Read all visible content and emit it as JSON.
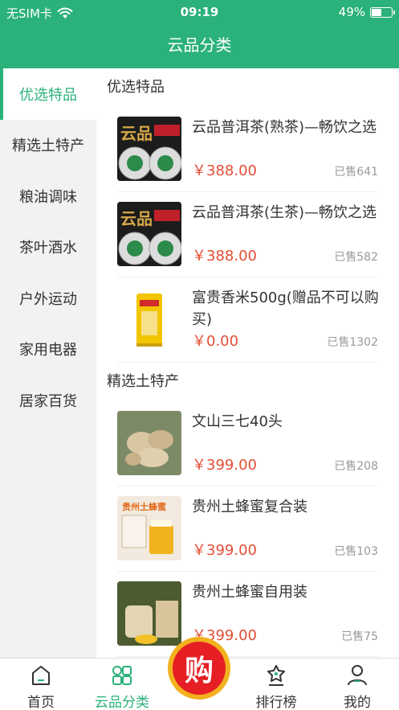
{
  "status": {
    "carrier": "无SIM卡",
    "time": "09:19",
    "battery": "49%",
    "battery_level": 0.49
  },
  "header": {
    "title": "云品分类"
  },
  "sidebar": {
    "items": [
      {
        "label": "优选特品",
        "active": true
      },
      {
        "label": "精选土特产",
        "active": false
      },
      {
        "label": "粮油调味",
        "active": false
      },
      {
        "label": "茶叶酒水",
        "active": false
      },
      {
        "label": "户外运动",
        "active": false
      },
      {
        "label": "家用电器",
        "active": false
      },
      {
        "label": "居家百货",
        "active": false
      }
    ]
  },
  "sections": [
    {
      "title": "优选特品",
      "products": [
        {
          "name": "云品普洱茶(熟茶)—畅饮之选",
          "price": "￥388.00",
          "sold": "已售641",
          "image_text": "云品"
        },
        {
          "name": "云品普洱茶(生茶)—畅饮之选",
          "price": "￥388.00",
          "sold": "已售582",
          "image_text": "云品"
        },
        {
          "name": "富贵香米500g(赠品不可以购买)",
          "price": "￥0.00",
          "sold": "已售1302"
        }
      ]
    },
    {
      "title": "精选土特产",
      "products": [
        {
          "name": "文山三七40头",
          "price": "￥399.00",
          "sold": "已售208"
        },
        {
          "name": "贵州土蜂蜜复合装",
          "price": "￥399.00",
          "sold": "已售103",
          "image_text": "贵州土蜂蜜"
        },
        {
          "name": "贵州土蜂蜜自用装",
          "price": "￥399.00",
          "sold": "已售75"
        }
      ]
    }
  ],
  "tabbar": {
    "items": [
      {
        "label": "首页",
        "icon": "home-icon"
      },
      {
        "label": "云品分类",
        "icon": "category-icon",
        "active": true
      },
      {
        "label": "排行榜",
        "icon": "ranking-icon"
      },
      {
        "label": "我的",
        "icon": "profile-icon"
      }
    ],
    "buy_label": "购"
  },
  "colors": {
    "brand": "#2bb17a",
    "price": "#e34e35",
    "buy_outer": "#f2b11e",
    "buy_inner": "#e51f24"
  }
}
